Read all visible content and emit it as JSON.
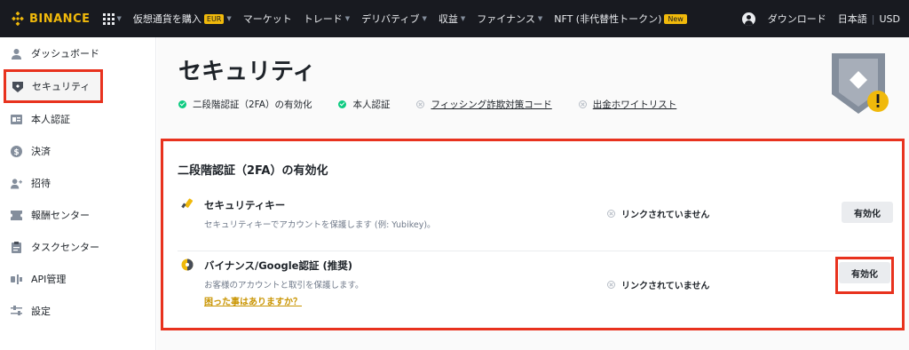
{
  "header": {
    "brand": "BINANCE",
    "nav": [
      {
        "label": "仮想通貨を購入",
        "badge": "EUR",
        "caret": true
      },
      {
        "label": "マーケット",
        "caret": false
      },
      {
        "label": "トレード",
        "caret": true
      },
      {
        "label": "デリバティブ",
        "caret": true
      },
      {
        "label": "収益",
        "caret": true
      },
      {
        "label": "ファイナンス",
        "caret": true
      },
      {
        "label": "NFT (非代替性トークン)",
        "badge": "New",
        "caret": false
      }
    ],
    "download": "ダウンロード",
    "language": "日本語",
    "currency": "USD"
  },
  "sidebar": {
    "items": [
      {
        "label": "ダッシュボード",
        "icon": "user-icon"
      },
      {
        "label": "セキュリティ",
        "icon": "shield-icon",
        "active": true
      },
      {
        "label": "本人認証",
        "icon": "id-card-icon"
      },
      {
        "label": "決済",
        "icon": "dollar-icon"
      },
      {
        "label": "招待",
        "icon": "add-user-icon"
      },
      {
        "label": "報酬センター",
        "icon": "ticket-icon"
      },
      {
        "label": "タスクセンター",
        "icon": "clipboard-icon"
      },
      {
        "label": "API管理",
        "icon": "api-icon"
      },
      {
        "label": "設定",
        "icon": "sliders-icon"
      }
    ]
  },
  "main": {
    "title": "セキュリティ",
    "status": [
      {
        "label": "二段階認証（2FA）の有効化",
        "state": "ok",
        "link": false
      },
      {
        "label": "本人認証",
        "state": "ok",
        "link": false
      },
      {
        "label": "フィッシング詐欺対策コード",
        "state": "off",
        "link": true
      },
      {
        "label": "出金ホワイトリスト",
        "state": "off",
        "link": true
      }
    ],
    "twofa": {
      "title": "二段階認証（2FA）の有効化",
      "rows": [
        {
          "title": "セキュリティキー",
          "desc": "セキュリティキーでアカウントを保護します (例: Yubikey)。",
          "status": "リンクされていません",
          "button": "有効化",
          "icon": "security-key-icon"
        },
        {
          "title": "バイナンス/Google認証 (推奨)",
          "desc": "お客様のアカウントと取引を保護します。",
          "help": "困った事はありますか？",
          "status": "リンクされていません",
          "button": "有効化",
          "icon": "authenticator-icon"
        }
      ]
    }
  },
  "colors": {
    "brand": "#f0b90b",
    "topbar": "#181a20",
    "highlight": "#e8321e",
    "success": "#0ecb81"
  }
}
